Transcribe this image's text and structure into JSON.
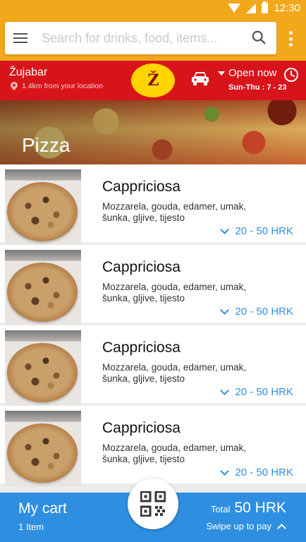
{
  "status_bar": {
    "time": "12:30"
  },
  "search": {
    "placeholder": "Search for drinks, food, items..."
  },
  "shop": {
    "name": "Žujabar",
    "distance": "1.4km from your location",
    "open_status": "Open now",
    "hours": "Sun-Thu : 7 - 23"
  },
  "category": {
    "title": "Pizza"
  },
  "items": [
    {
      "name": "Cappriciosa",
      "description": "Mozzarela, gouda, edamer, umak, šunka, gljive, tijesto",
      "price": "20 - 50 HRK"
    },
    {
      "name": "Cappriciosa",
      "description": "Mozzarela, gouda, edamer, umak, šunka, gljive, tijesto",
      "price": "20 - 50 HRK"
    },
    {
      "name": "Cappriciosa",
      "description": "Mozzarela, gouda, edamer, umak, šunka, gljive, tijesto",
      "price": "20 - 50 HRK"
    },
    {
      "name": "Cappriciosa",
      "description": "Mozzarela, gouda, edamer, umak, šunka, gljive, tijesto",
      "price": "20 - 50 HRK"
    }
  ],
  "cart": {
    "title": "My cart",
    "count": "1 Item",
    "total_label": "Total",
    "total_value": "50 HRK",
    "swipe_hint": "Swipe up to pay"
  },
  "colors": {
    "accent": "#f2a81b",
    "brand_red": "#d7141a",
    "link_blue": "#2e8fe0"
  },
  "icons": [
    "menu-icon",
    "search-icon",
    "more-vert-icon",
    "location-pin-icon",
    "car-icon",
    "caret-down-icon",
    "clock-icon",
    "chevron-down-icon",
    "qr-code-icon",
    "chevron-up-icon",
    "wifi-icon",
    "signal-icon",
    "battery-icon"
  ]
}
